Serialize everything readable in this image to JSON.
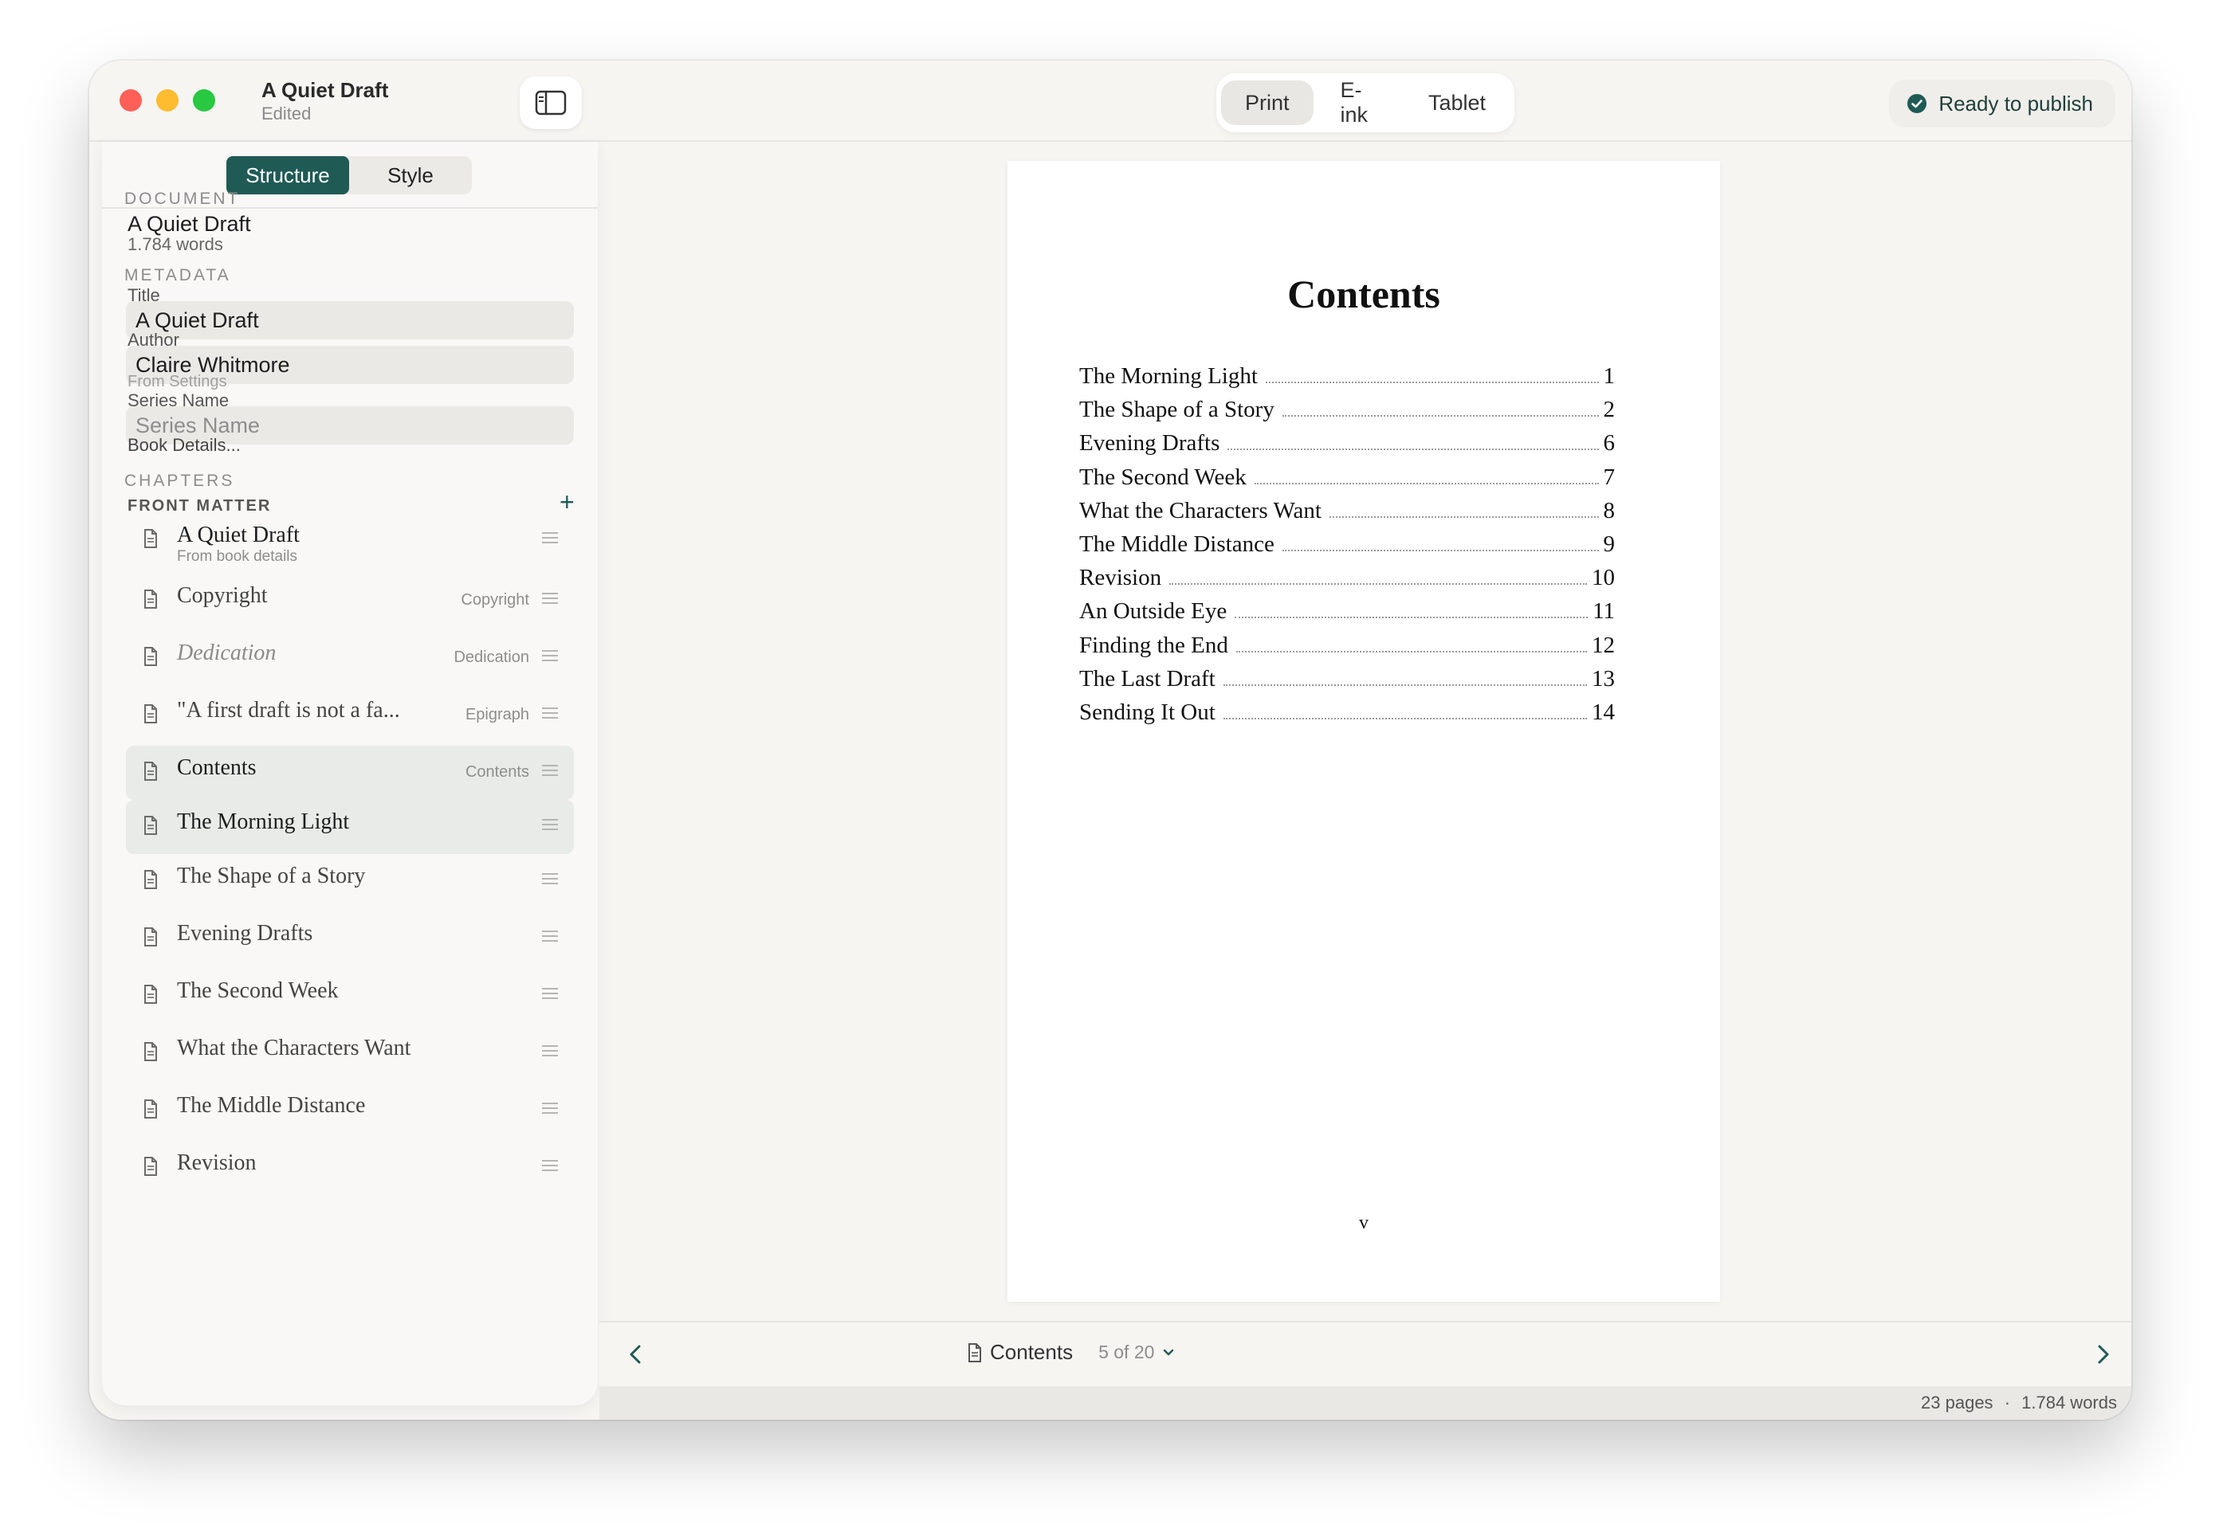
{
  "window": {
    "title": "A Quiet Draft",
    "subtitle": "Edited"
  },
  "formats": [
    {
      "label": "Print",
      "active": true
    },
    {
      "label": "E-ink",
      "active": false
    },
    {
      "label": "Tablet",
      "active": false
    }
  ],
  "publish_label": "Ready to publish",
  "sidebar": {
    "tabs": [
      "Structure",
      "Style"
    ],
    "document": {
      "heading": "DOCUMENT",
      "name": "A Quiet Draft",
      "words": "1.784 words"
    },
    "metadata": {
      "heading": "METADATA",
      "title_label": "Title",
      "title_value": "A Quiet Draft",
      "author_label": "Author",
      "author_value": "Claire Whitmore",
      "author_note": "From Settings",
      "series_label": "Series Name",
      "series_placeholder": "Series Name",
      "book_details": "Book Details..."
    },
    "chapters_heading": "CHAPTERS",
    "front_matter": "FRONT MATTER",
    "chapters": [
      {
        "title": "A Quiet Draft",
        "sub": "From book details",
        "tag": ""
      },
      {
        "title": "Copyright",
        "sub": "",
        "tag": "Copyright"
      },
      {
        "title": "Dedication",
        "sub": "",
        "tag": "Dedication"
      },
      {
        "title": "\"A first draft is not a fa...",
        "sub": "",
        "tag": "Epigraph"
      },
      {
        "title": "Contents",
        "sub": "",
        "tag": "Contents"
      },
      {
        "title": "The Morning Light",
        "sub": "",
        "tag": ""
      },
      {
        "title": "The Shape of a Story",
        "sub": "",
        "tag": ""
      },
      {
        "title": "Evening Drafts",
        "sub": "",
        "tag": ""
      },
      {
        "title": "The Second Week",
        "sub": "",
        "tag": ""
      },
      {
        "title": "What the Characters Want",
        "sub": "",
        "tag": ""
      },
      {
        "title": "The Middle Distance",
        "sub": "",
        "tag": ""
      },
      {
        "title": "Revision",
        "sub": "",
        "tag": ""
      }
    ]
  },
  "page": {
    "title": "Contents",
    "toc": [
      {
        "title": "The Morning Light",
        "page": "1"
      },
      {
        "title": "The Shape of a Story",
        "page": "2"
      },
      {
        "title": "Evening Drafts",
        "page": "6"
      },
      {
        "title": "The Second Week",
        "page": "7"
      },
      {
        "title": "What the Characters Want",
        "page": "8"
      },
      {
        "title": "The Middle Distance",
        "page": "9"
      },
      {
        "title": "Revision",
        "page": "10"
      },
      {
        "title": "An Outside Eye",
        "page": "11"
      },
      {
        "title": "Finding the End",
        "page": "12"
      },
      {
        "title": "The Last Draft",
        "page": "13"
      },
      {
        "title": "Sending It Out",
        "page": "14"
      }
    ],
    "folio": "v"
  },
  "bottom": {
    "section": "Contents",
    "position": "5 of 20"
  },
  "status": {
    "pages": "23 pages",
    "sep": "·",
    "words": "1.784 words"
  },
  "colors": {
    "accent": "#1f5a55",
    "selected_row": "#e9ebe8"
  }
}
